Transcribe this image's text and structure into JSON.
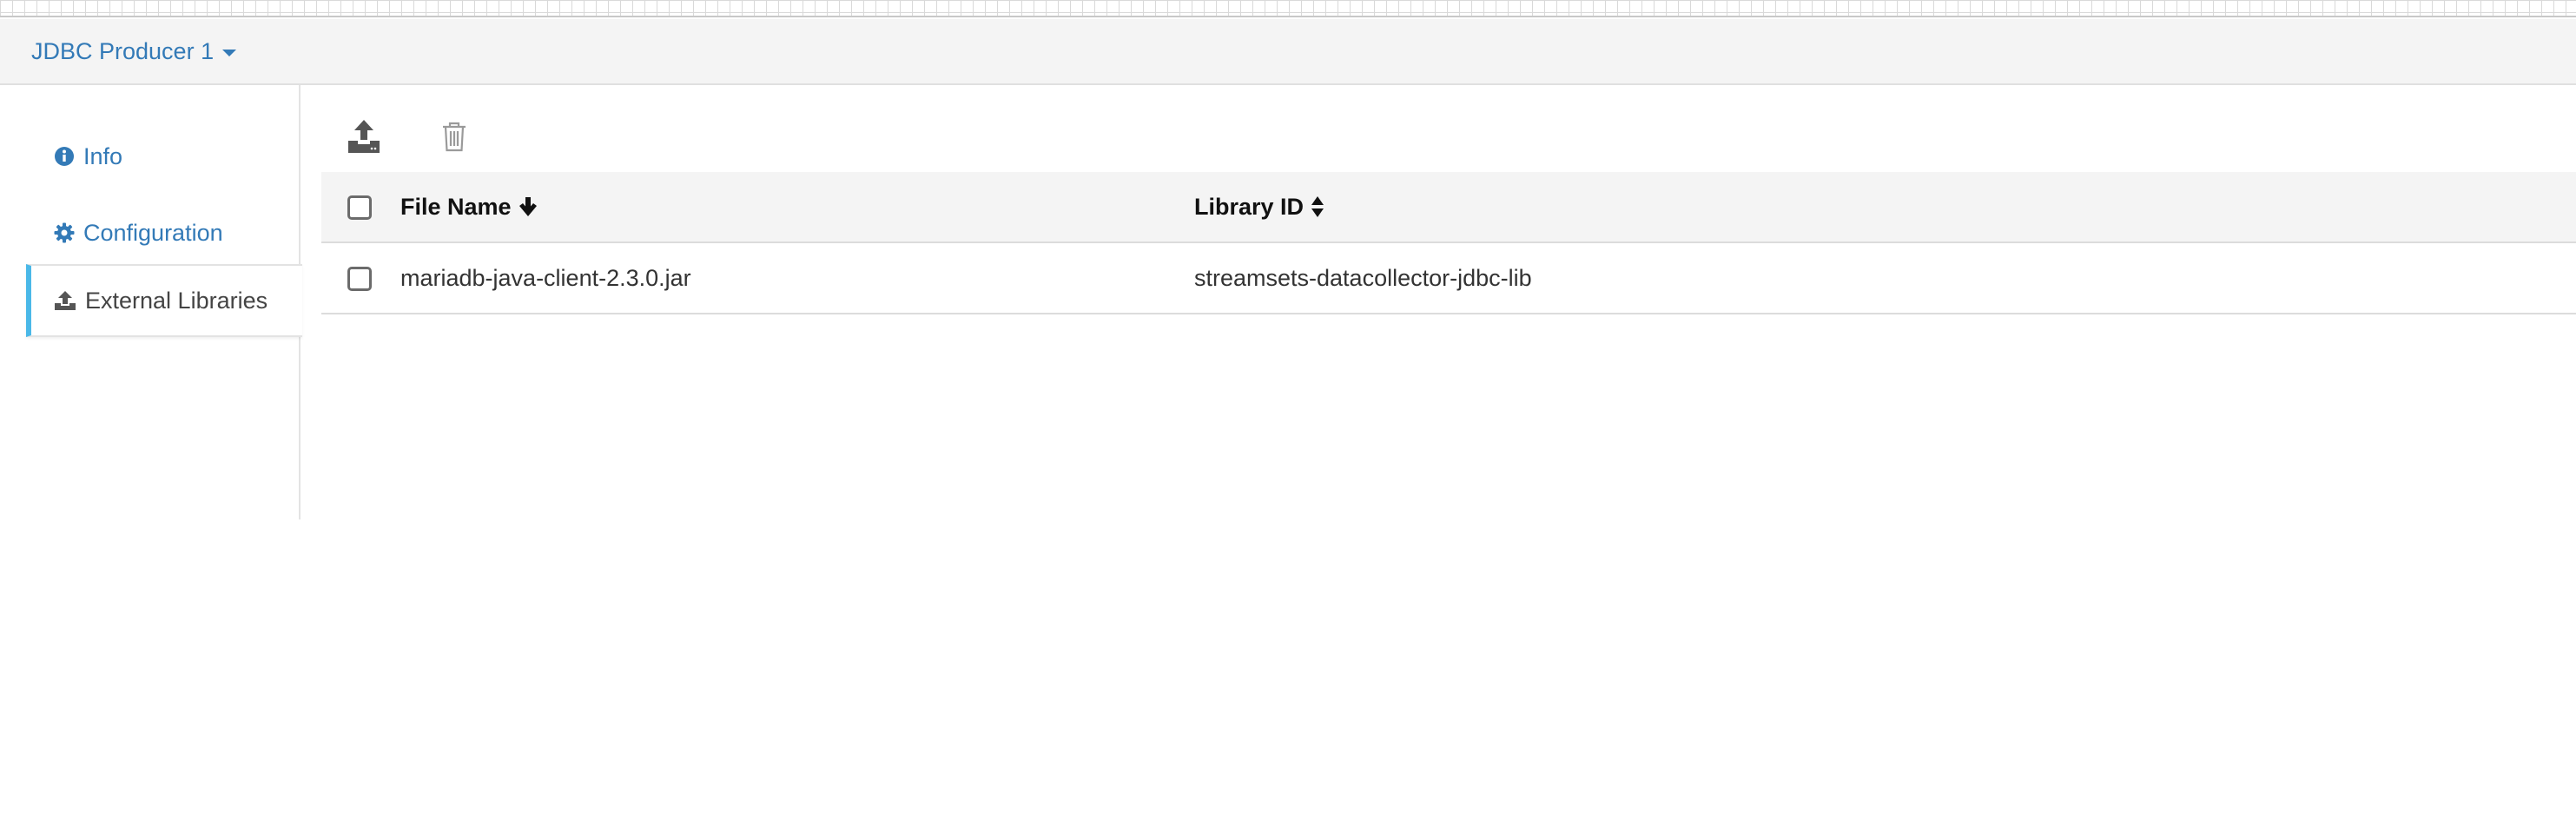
{
  "header": {
    "stage_title": "JDBC Producer 1"
  },
  "sidebar": {
    "items": [
      {
        "label": "Info",
        "icon": "info-circle-icon",
        "active": false
      },
      {
        "label": "Configuration",
        "icon": "gear-icon",
        "active": false
      },
      {
        "label": "External Libraries",
        "icon": "upload-icon",
        "active": true
      }
    ]
  },
  "toolbar": {
    "upload_icon": "upload-tray-icon",
    "delete_icon": "trash-icon"
  },
  "table": {
    "columns": [
      {
        "label": "File Name",
        "sort_icon": "arrow-down-icon"
      },
      {
        "label": "Library ID",
        "sort_icon": "sort-icon"
      }
    ],
    "rows": [
      {
        "file_name": "mariadb-java-client-2.3.0.jar",
        "library_id": "streamsets-datacollector-jdbc-lib"
      }
    ]
  },
  "colors": {
    "link": "#337ab7",
    "active_accent": "#4ab8e8",
    "header_bg": "#f4f4f4"
  }
}
